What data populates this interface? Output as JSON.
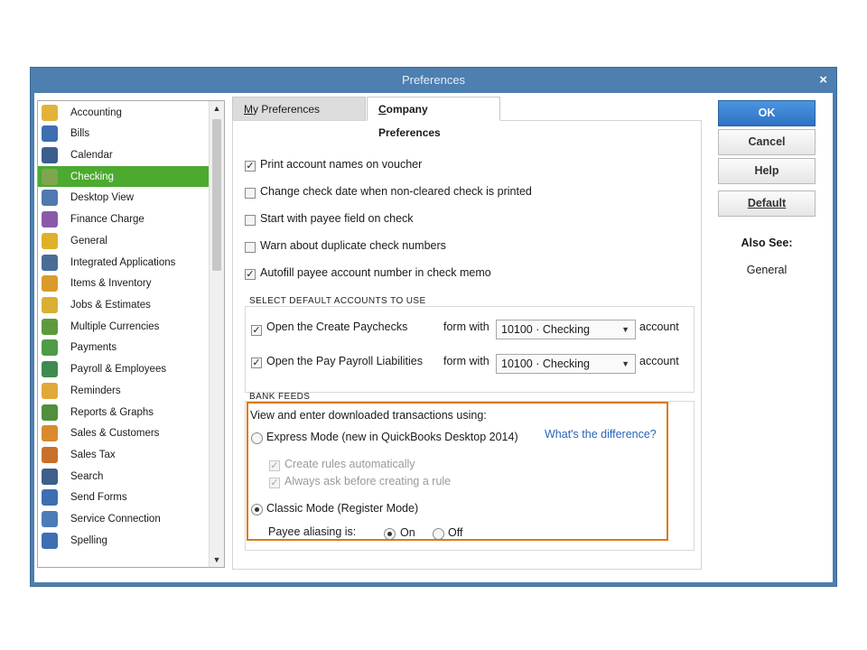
{
  "window": {
    "title": "Preferences",
    "close_glyph": "×"
  },
  "categories": [
    {
      "label": "Accounting",
      "icon": "accounting-icon",
      "color": "#e2b33a"
    },
    {
      "label": "Bills",
      "icon": "bills-icon",
      "color": "#3d6fb2"
    },
    {
      "label": "Calendar",
      "icon": "calendar-icon",
      "color": "#3c5e8c"
    },
    {
      "label": "Checking",
      "icon": "checking-icon",
      "color": "#7fa64f",
      "selected": true
    },
    {
      "label": "Desktop View",
      "icon": "desktop-view-icon",
      "color": "#4f79b0"
    },
    {
      "label": "Finance Charge",
      "icon": "finance-charge-icon",
      "color": "#8a5aa8"
    },
    {
      "label": "General",
      "icon": "general-icon",
      "color": "#e0b02b"
    },
    {
      "label": "Integrated Applications",
      "icon": "integrated-applications-icon",
      "color": "#4a6d95"
    },
    {
      "label": "Items & Inventory",
      "icon": "items-inventory-icon",
      "color": "#d99b2b"
    },
    {
      "label": "Jobs & Estimates",
      "icon": "jobs-estimates-icon",
      "color": "#d9b035"
    },
    {
      "label": "Multiple Currencies",
      "icon": "multiple-currencies-icon",
      "color": "#5d9a3f"
    },
    {
      "label": "Payments",
      "icon": "payments-icon",
      "color": "#4f9b46"
    },
    {
      "label": "Payroll & Employees",
      "icon": "payroll-employees-icon",
      "color": "#3f8a4f"
    },
    {
      "label": "Reminders",
      "icon": "reminders-icon",
      "color": "#e0a93a"
    },
    {
      "label": "Reports & Graphs",
      "icon": "reports-graphs-icon",
      "color": "#4f8f3d"
    },
    {
      "label": "Sales & Customers",
      "icon": "sales-customers-icon",
      "color": "#d98a2e"
    },
    {
      "label": "Sales Tax",
      "icon": "sales-tax-icon",
      "color": "#c8702a"
    },
    {
      "label": "Search",
      "icon": "search-icon",
      "color": "#3d5f8a"
    },
    {
      "label": "Send Forms",
      "icon": "send-forms-icon",
      "color": "#3d6fb2"
    },
    {
      "label": "Service Connection",
      "icon": "service-connection-icon",
      "color": "#4d7bb8"
    },
    {
      "label": "Spelling",
      "icon": "spelling-icon",
      "color": "#3d6fb2"
    }
  ],
  "tabs": {
    "my_preferences": {
      "underline": "M",
      "rest": "y Preferences"
    },
    "company_preferences": {
      "underline": "C",
      "rest": "ompany Preferences"
    }
  },
  "options": [
    {
      "label": "Print account names on voucher",
      "checked": true
    },
    {
      "label": "Change check date when non-cleared check is printed",
      "checked": false
    },
    {
      "label": "Start with payee field on check",
      "checked": false
    },
    {
      "label": "Warn about duplicate check numbers",
      "checked": false
    },
    {
      "label": "Autofill payee account number in check memo",
      "checked": true
    }
  ],
  "default_accounts": {
    "title": "SELECT DEFAULT ACCOUNTS TO USE",
    "rows": [
      {
        "label": "Open the Create Paychecks",
        "checked": true,
        "form_with": "form with",
        "account_value": "10100 · Checking",
        "suffix": "account"
      },
      {
        "label": "Open the Pay Payroll Liabilities",
        "checked": true,
        "form_with": "form with",
        "account_value": "10100 · Checking",
        "suffix": "account"
      }
    ]
  },
  "bank_feeds": {
    "title": "BANK FEEDS",
    "intro": "View and enter downloaded transactions using:",
    "express_mode": "Express Mode (new in QuickBooks Desktop 2014)",
    "difference_link": "What's the difference?",
    "create_rules": "Create rules automatically",
    "always_ask": "Always ask before creating a rule",
    "classic_mode": "Classic Mode (Register Mode)",
    "payee_aliasing": "Payee aliasing is:",
    "on": "On",
    "off": "Off",
    "selected_mode": "Classic Mode (Register Mode)",
    "payee_aliasing_value": "On"
  },
  "buttons": {
    "ok": "OK",
    "cancel": "Cancel",
    "help": "Help",
    "default": "Default"
  },
  "also_see": {
    "title": "Also See:",
    "link": "General"
  },
  "colors": {
    "accent": "#4caa2f",
    "title_bar": "#4d7fb0",
    "highlight": "#d97a17",
    "link": "#2a63b9"
  }
}
